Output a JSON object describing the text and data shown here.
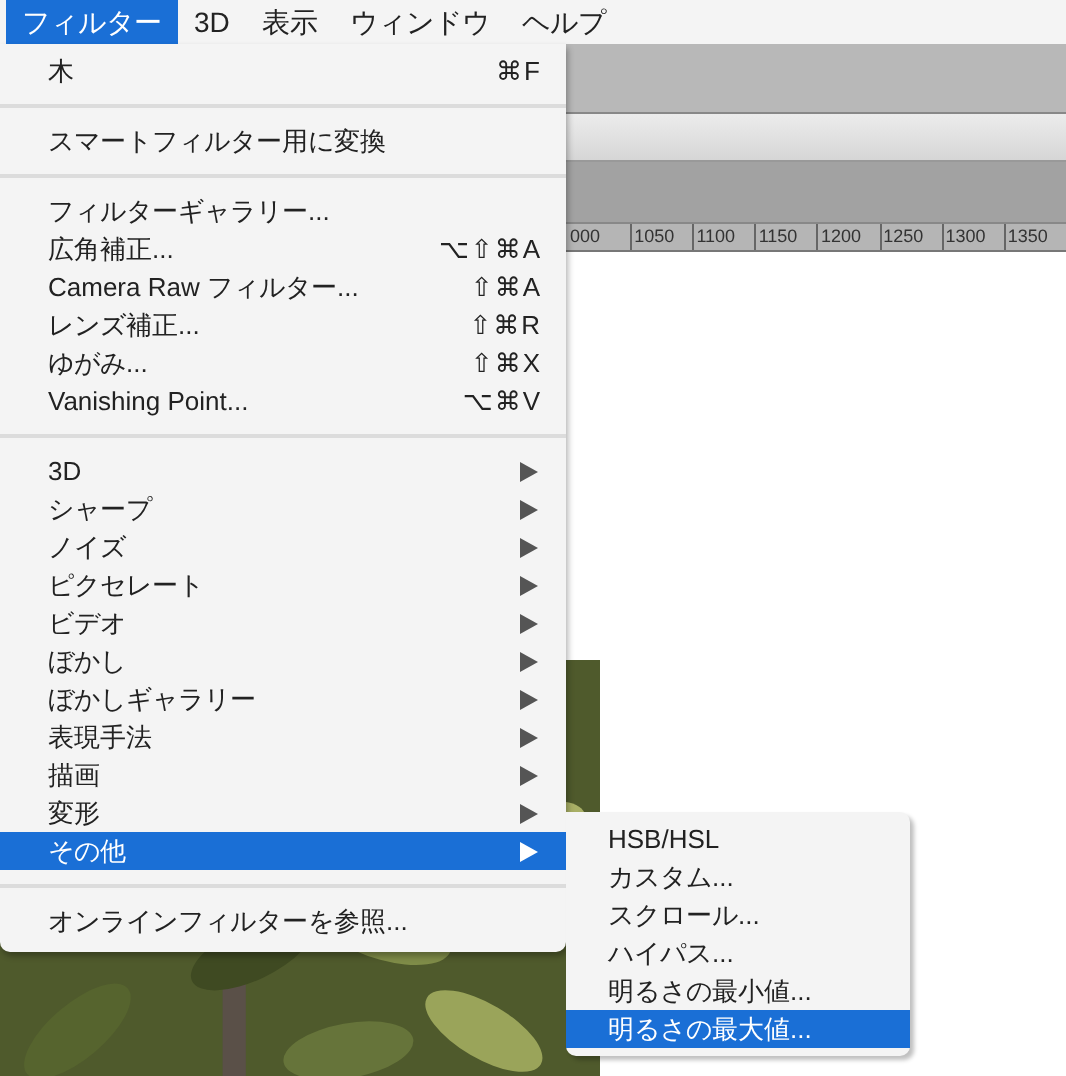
{
  "menu_bar": [
    {
      "label": "フィルター",
      "selected": true
    },
    {
      "label": "3D",
      "selected": false
    },
    {
      "label": "表示",
      "selected": false
    },
    {
      "label": "ウィンドウ",
      "selected": false
    },
    {
      "label": "ヘルプ",
      "selected": false
    }
  ],
  "ruler": [
    "000",
    "1050",
    "1100",
    "1150",
    "1200",
    "1250",
    "1300",
    "1350"
  ],
  "filter_menu": [
    {
      "kind": "item",
      "label": "木",
      "shortcut": "⌘F",
      "selected": false
    },
    {
      "kind": "separator"
    },
    {
      "kind": "item",
      "label": "スマートフィルター用に変換",
      "selected": false
    },
    {
      "kind": "separator"
    },
    {
      "kind": "item",
      "label": "フィルターギャラリー...",
      "selected": false
    },
    {
      "kind": "item",
      "label": "広角補正...",
      "shortcut": "⌥⇧⌘A",
      "selected": false
    },
    {
      "kind": "item",
      "label": "Camera Raw フィルター...",
      "shortcut": "⇧⌘A",
      "selected": false
    },
    {
      "kind": "item",
      "label": "レンズ補正...",
      "shortcut": "⇧⌘R",
      "selected": false
    },
    {
      "kind": "item",
      "label": "ゆがみ...",
      "shortcut": "⇧⌘X",
      "selected": false
    },
    {
      "kind": "item",
      "label": "Vanishing Point...",
      "shortcut": "⌥⌘V",
      "selected": false
    },
    {
      "kind": "separator"
    },
    {
      "kind": "submenu",
      "label": "3D",
      "selected": false
    },
    {
      "kind": "submenu",
      "label": "シャープ",
      "selected": false
    },
    {
      "kind": "submenu",
      "label": "ノイズ",
      "selected": false
    },
    {
      "kind": "submenu",
      "label": "ピクセレート",
      "selected": false
    },
    {
      "kind": "submenu",
      "label": "ビデオ",
      "selected": false
    },
    {
      "kind": "submenu",
      "label": "ぼかし",
      "selected": false
    },
    {
      "kind": "submenu",
      "label": "ぼかしギャラリー",
      "selected": false
    },
    {
      "kind": "submenu",
      "label": "表現手法",
      "selected": false
    },
    {
      "kind": "submenu",
      "label": "描画",
      "selected": false
    },
    {
      "kind": "submenu",
      "label": "変形",
      "selected": false
    },
    {
      "kind": "submenu",
      "label": "その他",
      "selected": true
    },
    {
      "kind": "separator"
    },
    {
      "kind": "item",
      "label": "オンラインフィルターを参照...",
      "selected": false
    }
  ],
  "other_submenu": [
    {
      "label": "HSB/HSL",
      "selected": false
    },
    {
      "label": "カスタム...",
      "selected": false
    },
    {
      "label": "スクロール...",
      "selected": false
    },
    {
      "label": "ハイパス...",
      "selected": false
    },
    {
      "label": "明るさの最小値...",
      "selected": false
    },
    {
      "label": "明るさの最大値...",
      "selected": true
    }
  ]
}
